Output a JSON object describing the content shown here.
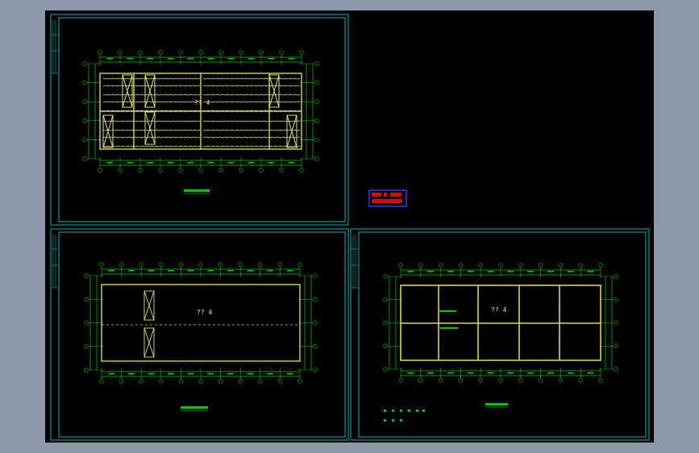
{
  "app": {
    "background": "#8e97a7",
    "viewport_background": "#000000"
  },
  "colors": {
    "frame": "#00b7b7",
    "wall": "#d8d840",
    "axis": "#00c800",
    "detail": "#e0e070",
    "stamp_fill": "#cc1010",
    "stamp_border": "#2040ff"
  },
  "sheets": {
    "top_left": {
      "room_label": "?? 4",
      "caption": ""
    },
    "bottom_left": {
      "room_label": "?? 4",
      "caption": ""
    },
    "bottom_right": {
      "room_label": "?? 4",
      "caption": "",
      "notes": [
        "",
        ""
      ]
    }
  },
  "stamp": {
    "line1": "",
    "line2": ""
  }
}
